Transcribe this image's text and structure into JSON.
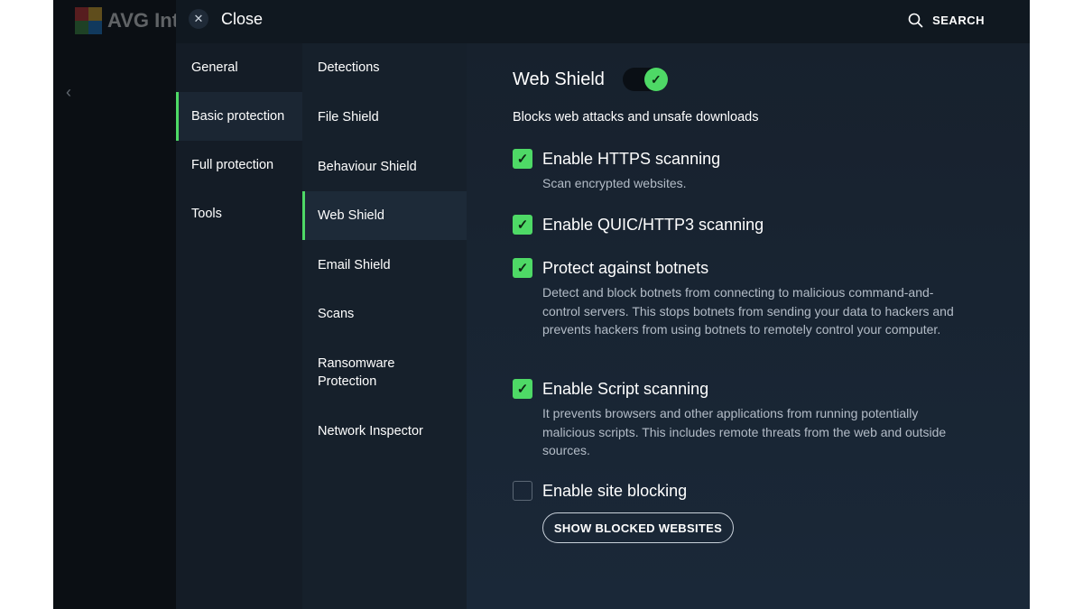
{
  "background": {
    "logo_text": "AVG Int",
    "back_icon": "chevron-left-icon"
  },
  "header": {
    "close_label": "Close",
    "search_label": "SEARCH"
  },
  "nav": {
    "items": [
      {
        "label": "General",
        "active": false
      },
      {
        "label": "Basic protection",
        "active": true
      },
      {
        "label": "Full protection",
        "active": false
      },
      {
        "label": "Tools",
        "active": false
      }
    ]
  },
  "subnav": {
    "items": [
      {
        "label": "Detections",
        "active": false
      },
      {
        "label": "File Shield",
        "active": false
      },
      {
        "label": "Behaviour Shield",
        "active": false
      },
      {
        "label": "Web Shield",
        "active": true
      },
      {
        "label": "Email Shield",
        "active": false
      },
      {
        "label": "Scans",
        "active": false
      },
      {
        "label": "Ransomware Protection",
        "active": false
      },
      {
        "label": "Network Inspector",
        "active": false
      }
    ]
  },
  "content": {
    "title": "Web Shield",
    "enabled": true,
    "description": "Blocks web attacks and unsafe downloads",
    "options": [
      {
        "label": "Enable HTTPS scanning",
        "checked": true,
        "description": "Scan encrypted websites."
      },
      {
        "label": "Enable QUIC/HTTP3 scanning",
        "checked": true,
        "description": ""
      },
      {
        "label": "Protect against botnets",
        "checked": true,
        "description": "Detect and block botnets from connecting to malicious command-and-control servers. This stops botnets from sending your data to hackers and prevents hackers from using botnets to remotely control your computer."
      },
      {
        "label": "Enable Script scanning",
        "checked": true,
        "description": "It prevents browsers and other applications from running potentially malicious scripts. This includes remote threats from the web and outside sources."
      },
      {
        "label": "Enable site blocking",
        "checked": false,
        "description": ""
      }
    ],
    "show_blocked_label": "SHOW BLOCKED WEBSITES"
  },
  "colors": {
    "accent": "#4ed966",
    "panel_bg": "#111923",
    "content_bg": "#17212d"
  }
}
